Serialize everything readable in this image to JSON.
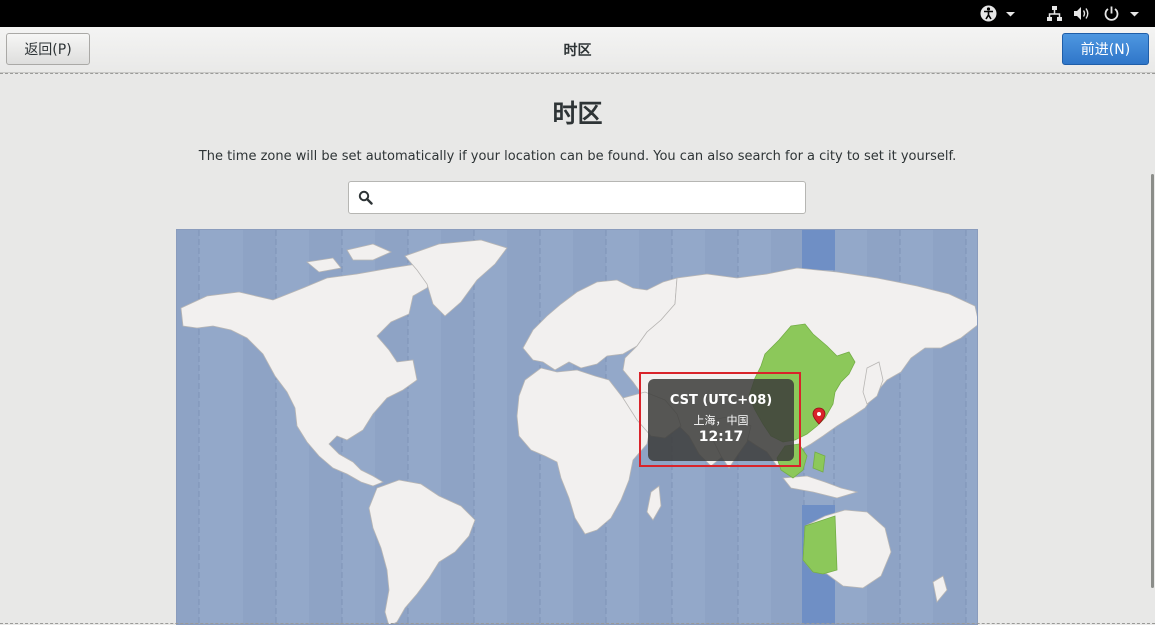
{
  "top_panel": {
    "icons": [
      "accessibility-icon",
      "chevron-down-icon",
      "network-icon",
      "volume-icon",
      "power-icon",
      "chevron-down-icon"
    ]
  },
  "header": {
    "back_label": "返回(P)",
    "title": "时区",
    "next_label": "前进(N)"
  },
  "page": {
    "title": "时区",
    "description": "The time zone will be set automatically if your location can be found. You can also search for a city to set it yourself."
  },
  "search": {
    "value": "",
    "placeholder": "",
    "icon": "search-icon"
  },
  "map": {
    "selected_zone": {
      "name": "CST (UTC+08)",
      "city": "上海，中国",
      "time": "12:17"
    },
    "colors": {
      "ocean": "#93a8c9",
      "land": "#f2f0ef",
      "selected_region": "#8cc85a",
      "selected_band": "#6f8fc5",
      "pin": "#d9232a"
    }
  }
}
